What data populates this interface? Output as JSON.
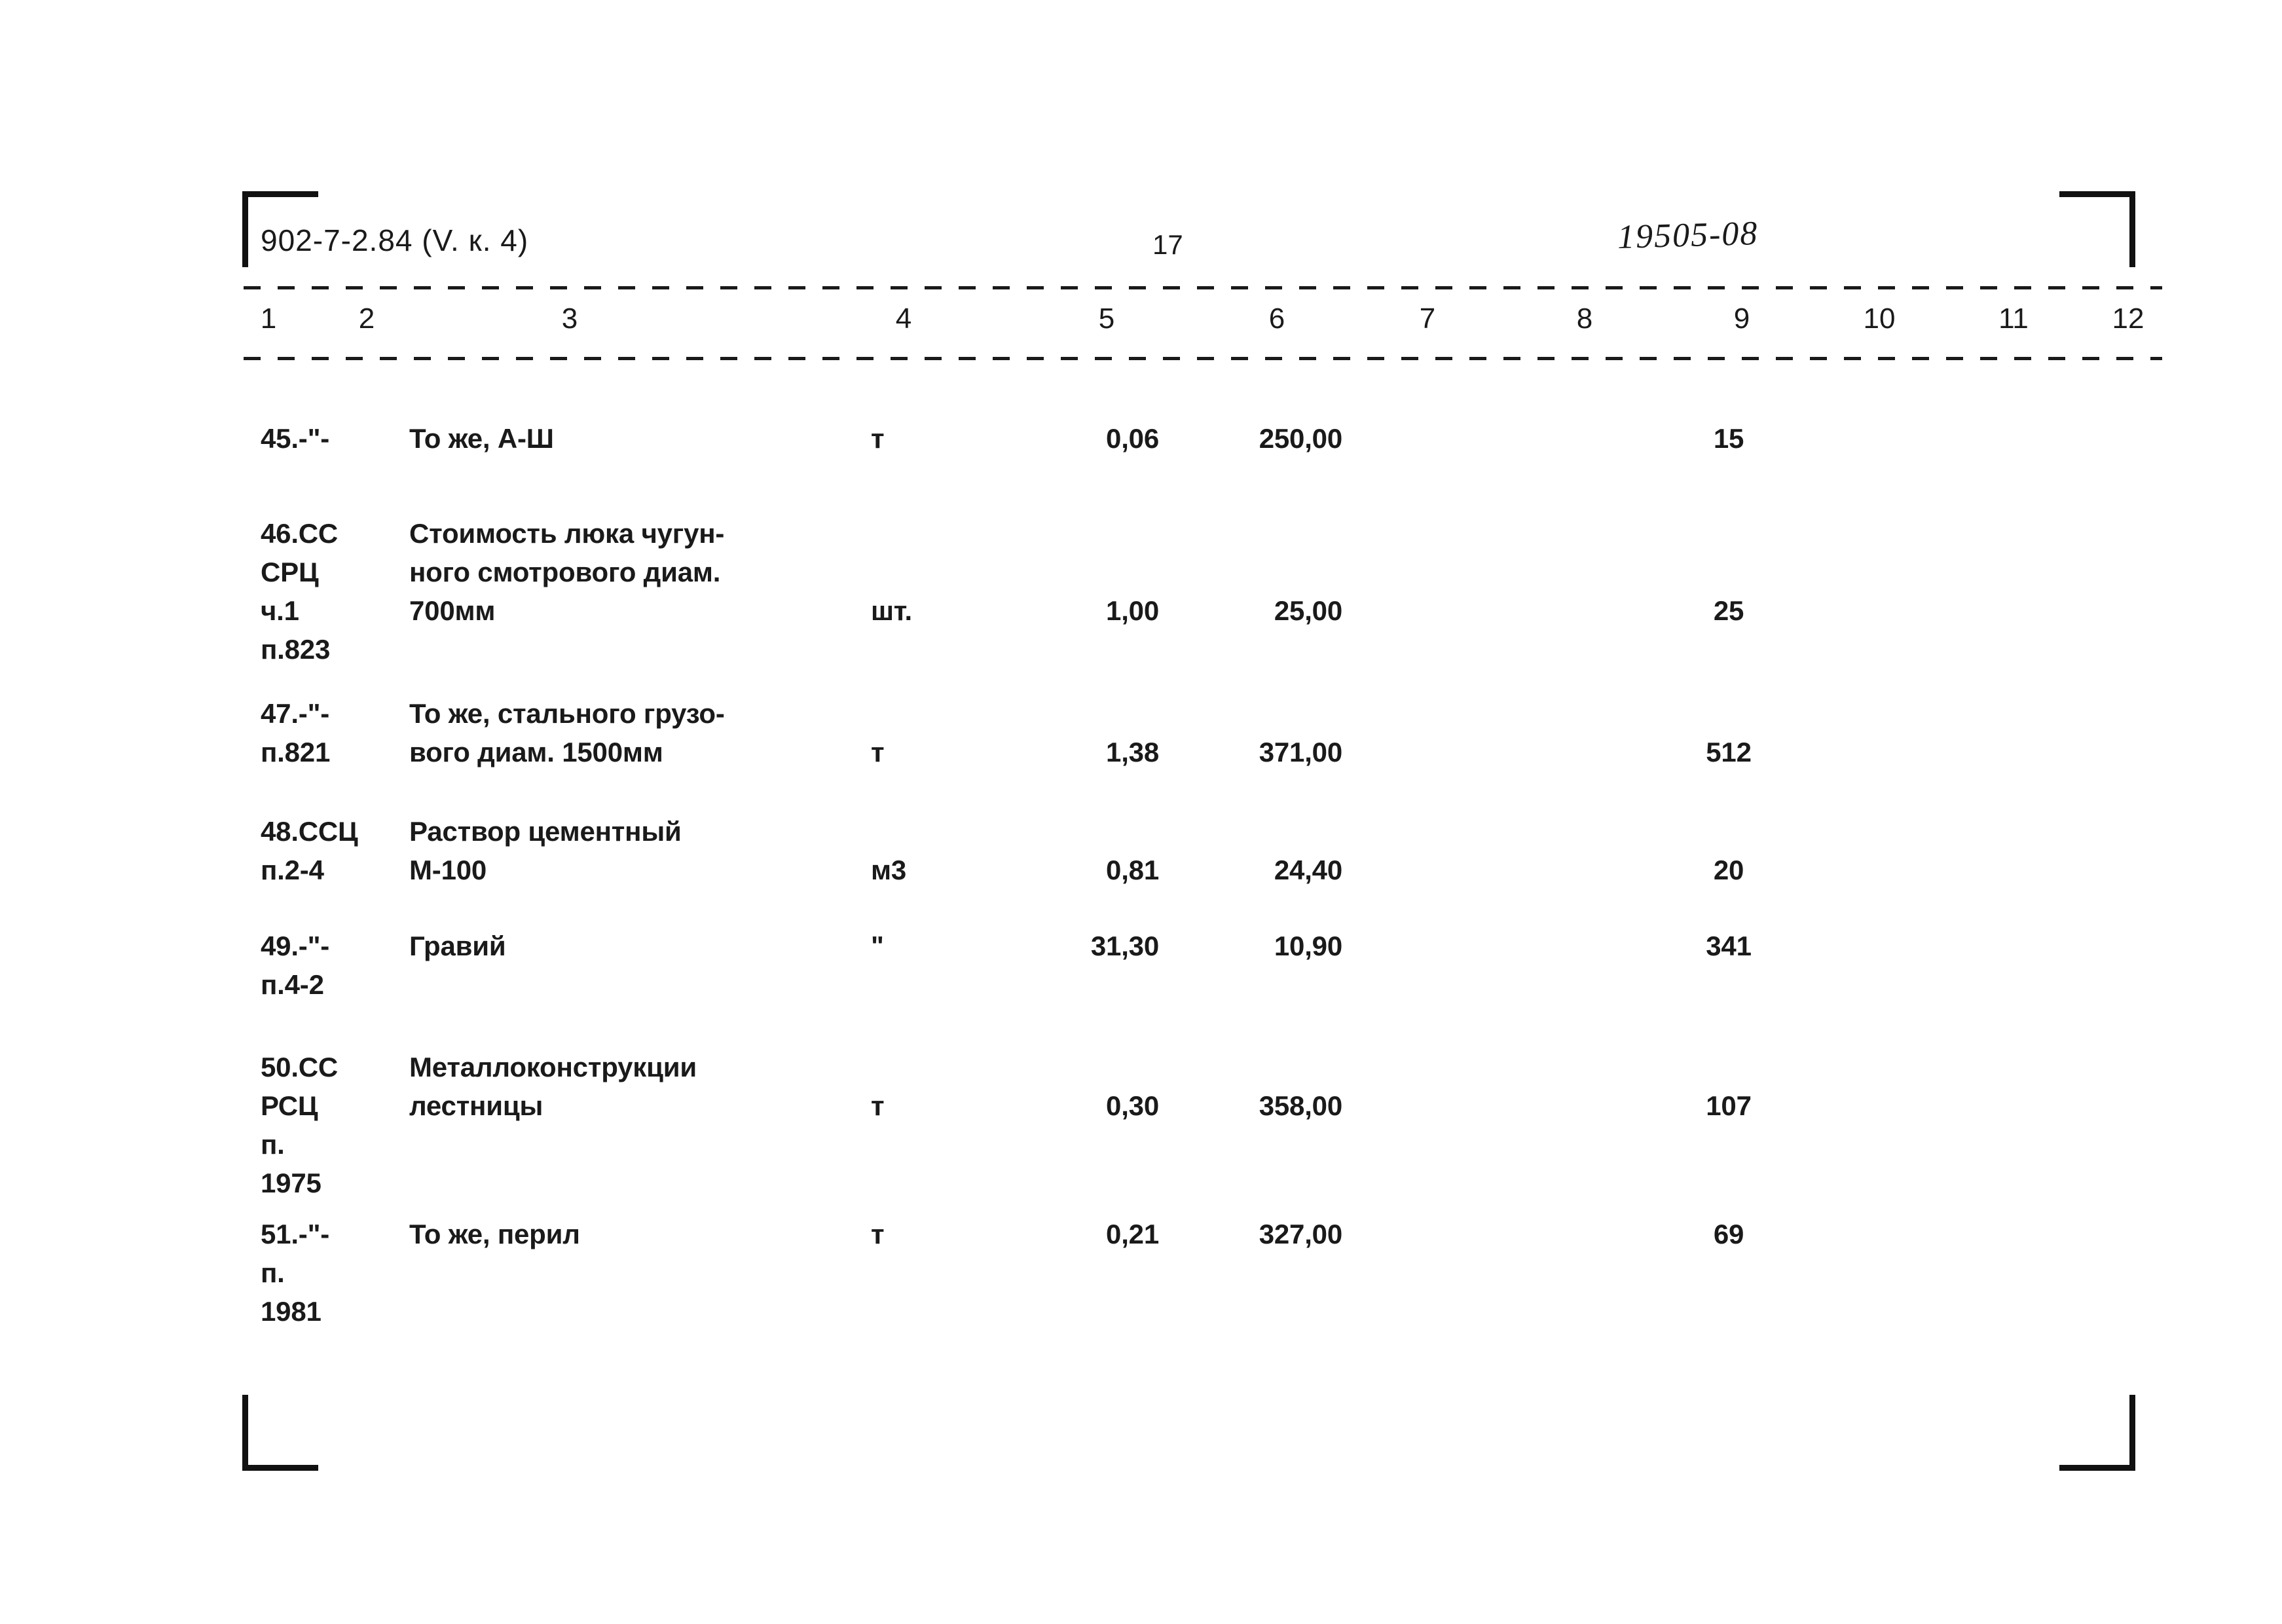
{
  "header": {
    "doc_code": "902-7-2.84 (V. к. 4)",
    "page_number": "17",
    "hand_code": "19505-08"
  },
  "table": {
    "column_numbers": [
      "1",
      "2",
      "3",
      "4",
      "5",
      "6",
      "7",
      "8",
      "9",
      "10",
      "11",
      "12"
    ],
    "rows": [
      {
        "code": "45.-\"-",
        "description": "То же, А-Ш",
        "unit": "т",
        "quantity": "0,06",
        "price": "250,00",
        "total": "15"
      },
      {
        "code": "46.СС\nСРЦ\nч.1\nп.823",
        "description": "Стоимость люка чугун-\nного смотрового диам.\n700мм",
        "unit": "шт.",
        "quantity": "1,00",
        "price": "25,00",
        "total": "25"
      },
      {
        "code": "47.-\"-\nп.821",
        "description": "То же, стального грузо-\nвого диам. 1500мм",
        "unit": "т",
        "quantity": "1,38",
        "price": "371,00",
        "total": "512"
      },
      {
        "code": "48.ССЦ\nп.2-4",
        "description": "Раствор цементный\nМ-100",
        "unit": "м3",
        "quantity": "0,81",
        "price": "24,40",
        "total": "20"
      },
      {
        "code": "49.-\"-\nп.4-2",
        "description": "Гравий",
        "unit": "\"",
        "quantity": "31,30",
        "price": "10,90",
        "total": "341"
      },
      {
        "code": "50.СС\nРСЦ\nп.\n1975",
        "description": "Металлоконструкции\nлестницы",
        "unit": "т",
        "quantity": "0,30",
        "price": "358,00",
        "total": "107"
      },
      {
        "code": "51.-\"-\nп.\n1981",
        "description": "То же, перил",
        "unit": "т",
        "quantity": "0,21",
        "price": "327,00",
        "total": "69"
      }
    ]
  }
}
